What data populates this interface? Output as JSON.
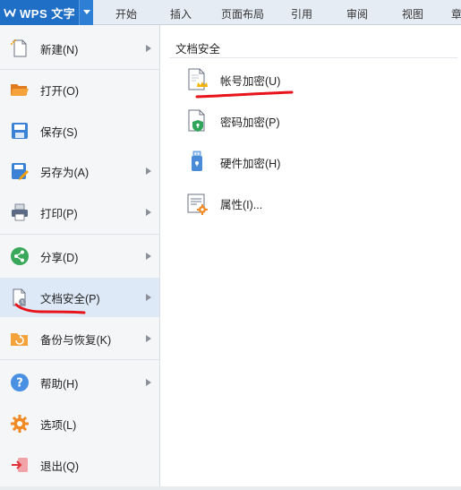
{
  "app": {
    "title": "WPS 文字",
    "accent_color": "#1f6fc6"
  },
  "ribbon_tabs": [
    {
      "label": "开始"
    },
    {
      "label": "插入"
    },
    {
      "label": "页面布局"
    },
    {
      "label": "引用"
    },
    {
      "label": "审阅"
    },
    {
      "label": "视图"
    },
    {
      "label": "章"
    }
  ],
  "menu": {
    "items": [
      {
        "label": "新建(N)",
        "icon": "new-document-icon",
        "has_submenu": true
      },
      {
        "label": "打开(O)",
        "icon": "open-folder-icon",
        "has_submenu": false
      },
      {
        "label": "保存(S)",
        "icon": "save-icon",
        "has_submenu": false
      },
      {
        "label": "另存为(A)",
        "icon": "save-as-icon",
        "has_submenu": true
      },
      {
        "label": "打印(P)",
        "icon": "printer-icon",
        "has_submenu": true
      },
      {
        "label": "分享(D)",
        "icon": "share-icon",
        "has_submenu": true
      },
      {
        "label": "文档安全(P)",
        "icon": "document-security-icon",
        "has_submenu": true,
        "active": true
      },
      {
        "label": "备份与恢复(K)",
        "icon": "backup-restore-icon",
        "has_submenu": true
      },
      {
        "label": "帮助(H)",
        "icon": "help-icon",
        "has_submenu": true
      },
      {
        "label": "选项(L)",
        "icon": "options-gear-icon",
        "has_submenu": false
      },
      {
        "label": "退出(Q)",
        "icon": "exit-icon",
        "has_submenu": false
      }
    ]
  },
  "submenu": {
    "title": "文档安全",
    "items": [
      {
        "label": "帐号加密(U)",
        "icon": "account-encrypt-icon"
      },
      {
        "label": "密码加密(P)",
        "icon": "password-encrypt-icon"
      },
      {
        "label": "硬件加密(H)",
        "icon": "usb-hardware-encrypt-icon"
      },
      {
        "label": "属性(I)...",
        "icon": "properties-icon"
      }
    ]
  },
  "annotation_color": "#e8141b"
}
